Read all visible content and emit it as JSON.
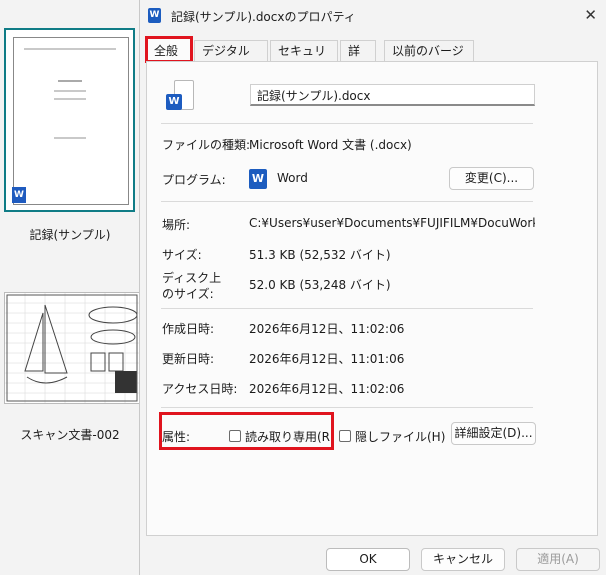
{
  "explorer": {
    "items": [
      {
        "label": "記録(サンプル)"
      },
      {
        "label": "スキャン文書-002"
      }
    ],
    "thumb_word_badge": "W"
  },
  "dialog": {
    "title": "記録(サンプル).docxのプロパティ",
    "close_glyph": "✕",
    "tabs": [
      "全般",
      "デジタル署名",
      "セキュリティ",
      "詳細",
      "以前のバージョン"
    ],
    "filename": "記録(サンプル).docx",
    "file_type_label": "ファイルの種類:",
    "file_type_value": "Microsoft Word 文書 (.docx)",
    "program_label": "プログラム:",
    "program_value": "Word",
    "change_button": "変更(C)...",
    "location_label": "場所:",
    "location_value": "C:¥Users¥user¥Documents¥FUJIFILM¥DocuWorks¥DWF",
    "size_label": "サイズ:",
    "size_value": "51.3 KB (52,532 バイト)",
    "disk_size_label_1": "ディスク上",
    "disk_size_label_2": "のサイズ:",
    "disk_size_value": "52.0 KB (53,248 バイト)",
    "created_label": "作成日時:",
    "created_value": "2026年6月12日、11:02:06",
    "modified_label": "更新日時:",
    "modified_value": "2026年6月12日、11:01:06",
    "accessed_label": "アクセス日時:",
    "accessed_value": "2026年6月12日、11:02:06",
    "attributes_label": "属性:",
    "readonly_label": "読み取り専用(R)",
    "hidden_label": "隠しファイル(H)",
    "advanced_button": "詳細設定(D)...",
    "ok_button": "OK",
    "cancel_button": "キャンセル",
    "apply_button": "適用(A)",
    "word_icon_letter": "W"
  },
  "colors": {
    "highlight": "#e0141e",
    "selection": "#0f7c86",
    "word_blue": "#1c5cbf"
  }
}
